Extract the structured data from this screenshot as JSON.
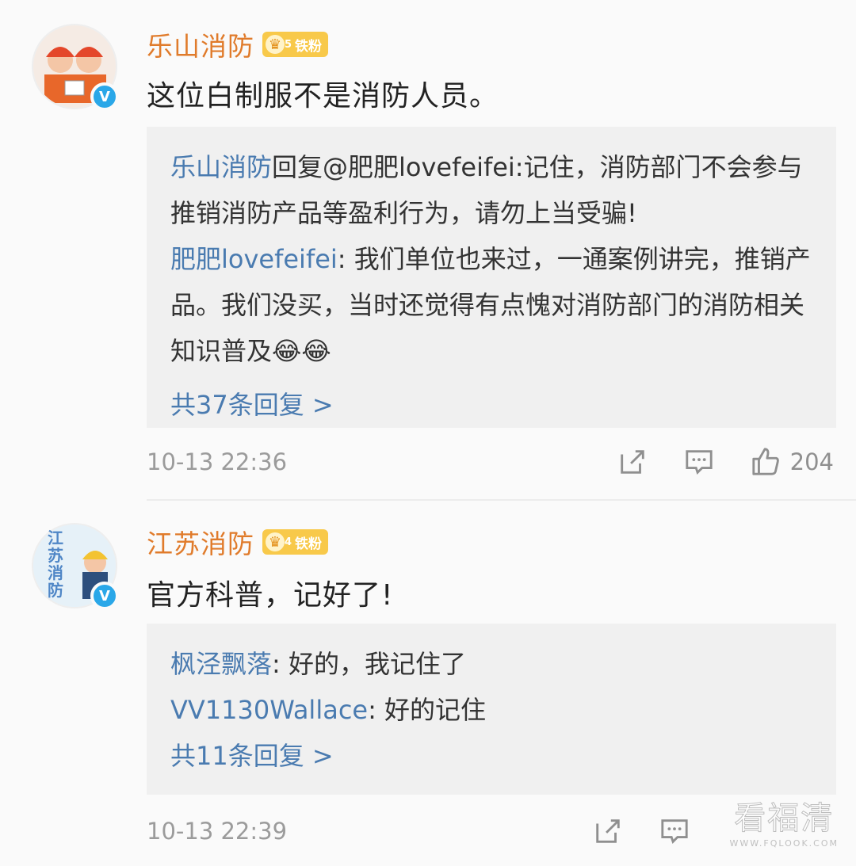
{
  "comments": [
    {
      "user": "乐山消防",
      "fan_badge_level": "5",
      "fan_badge_label": "铁粉",
      "text": "这位白制服不是消防人员。",
      "replies": [
        {
          "author": "乐山消防",
          "body": "回复@肥肥lovefeifei:记住，消防部门不会参与推销消防产品等盈利行为，请勿上当受骗!"
        },
        {
          "author": "肥肥lovefeifei",
          "body": ": 我们单位也来过，一通案例讲完，推销产品。我们没买，当时还觉得有点愧对消防部门的消防相关知识普及😂😂"
        }
      ],
      "more_replies": "共37条回复 >",
      "timestamp": "10-13 22:36",
      "likes": "204"
    },
    {
      "user": "江苏消防",
      "fan_badge_level": "4",
      "fan_badge_label": "铁粉",
      "text": "官方科普，记好了!",
      "avatar_text": "江苏消防",
      "replies": [
        {
          "author": "枫泾飘落",
          "body": ": 好的，我记住了"
        },
        {
          "author": "VV1130Wallace",
          "body": ": 好的记住"
        }
      ],
      "more_replies": "共11条回复 >",
      "timestamp": "10-13 22:39"
    }
  ],
  "watermark": {
    "main": "看福清",
    "sub": "WWW.FQLOOK.COM"
  },
  "icons": {
    "verified": "verified-v-icon",
    "share": "share-icon",
    "comment": "comment-icon",
    "like": "like-thumb-icon"
  },
  "colors": {
    "username": "#e07b2b",
    "reply_author": "#4a7bb0",
    "badge": "#f8c94a",
    "verified": "#2aa7e8"
  }
}
